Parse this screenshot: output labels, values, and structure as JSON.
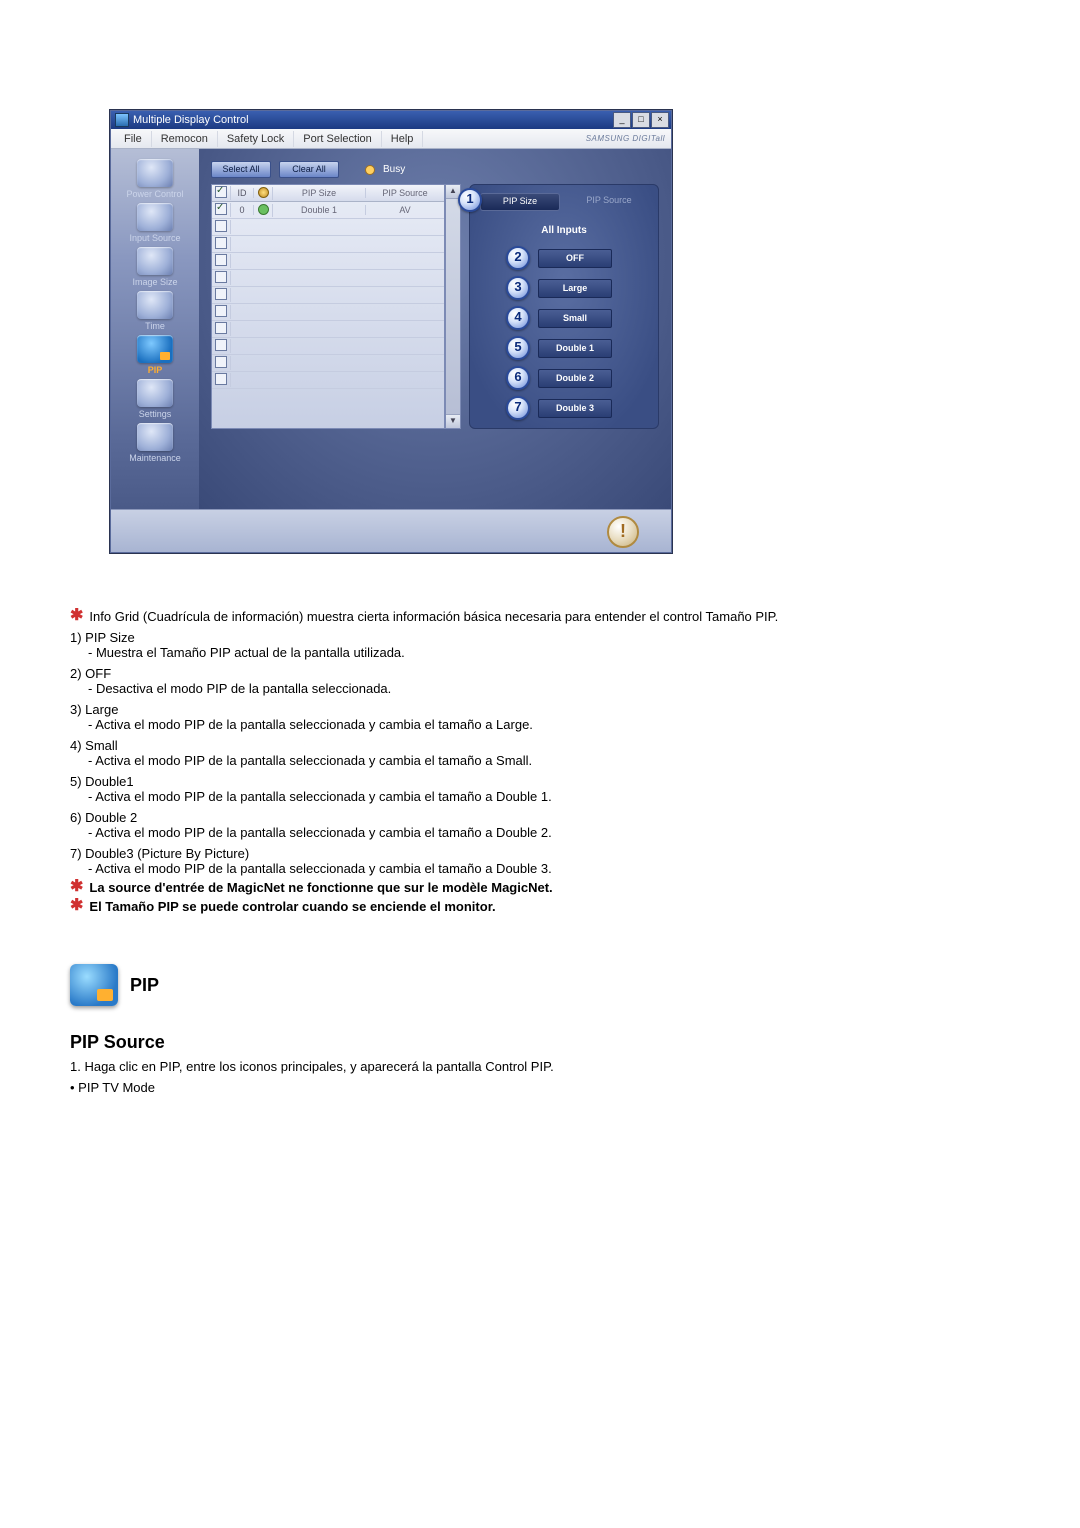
{
  "app": {
    "title": "Multiple Display Control",
    "brand": "SAMSUNG DIGITall"
  },
  "menu": [
    "File",
    "Remocon",
    "Safety Lock",
    "Port Selection",
    "Help"
  ],
  "sidebar": [
    {
      "label": "Power Control"
    },
    {
      "label": "Input Source"
    },
    {
      "label": "Image Size"
    },
    {
      "label": "Time"
    },
    {
      "label": "PIP"
    },
    {
      "label": "Settings"
    },
    {
      "label": "Maintenance"
    }
  ],
  "toolbar": {
    "select_all": "Select All",
    "clear_all": "Clear All",
    "busy": "Busy"
  },
  "grid": {
    "headers": {
      "id": "ID",
      "pip_size": "PIP Size",
      "pip_source": "PIP Source"
    },
    "rows": [
      {
        "checked": true,
        "id": "0",
        "status": "green",
        "pip_size": "Double 1",
        "pip_source": "AV"
      }
    ],
    "empty_row_count": 10
  },
  "right": {
    "tabs": {
      "pip_size": "PIP Size",
      "pip_source": "PIP Source"
    },
    "all_inputs": "All Inputs",
    "options": [
      "OFF",
      "Large",
      "Small",
      "Double 1",
      "Double 2",
      "Double 3"
    ]
  },
  "callouts": [
    "1",
    "2",
    "3",
    "4",
    "5",
    "6",
    "7"
  ],
  "doc": {
    "intro": "Info Grid (Cuadrícula de información) muestra cierta información básica necesaria para entender el control Tamaño PIP.",
    "items": [
      {
        "head": "1)  PIP Size",
        "desc": "- Muestra el Tamaño PIP actual de la pantalla utilizada."
      },
      {
        "head": "2)  OFF",
        "desc": "- Desactiva el modo PIP de la pantalla seleccionada."
      },
      {
        "head": "3)  Large",
        "desc": "- Activa el modo PIP de la pantalla seleccionada y cambia el tamaño a Large."
      },
      {
        "head": "4)  Small",
        "desc": "- Activa el modo PIP de la pantalla seleccionada y cambia el tamaño a Small."
      },
      {
        "head": "5)  Double1",
        "desc": "- Activa el modo PIP de la pantalla seleccionada y cambia el tamaño a Double 1."
      },
      {
        "head": "6)  Double 2",
        "desc": "- Activa el modo PIP de la pantalla seleccionada y cambia el tamaño a Double 2."
      },
      {
        "head": "7)  Double3 (Picture By Picture)",
        "desc": "- Activa el modo PIP de la pantalla seleccionada y cambia el tamaño a Double 3."
      }
    ],
    "note1": "La source d'entrée de MagicNet ne fonctionne que sur le modèle MagicNet.",
    "note2": "El Tamaño PIP se puede controlar cuando se enciende el monitor.",
    "section_label": "PIP",
    "subhead": "PIP Source",
    "steps": [
      "1.  Haga clic en PIP, entre los iconos principales, y aparecerá la pantalla Control PIP."
    ],
    "bullet": "• PIP TV Mode"
  }
}
